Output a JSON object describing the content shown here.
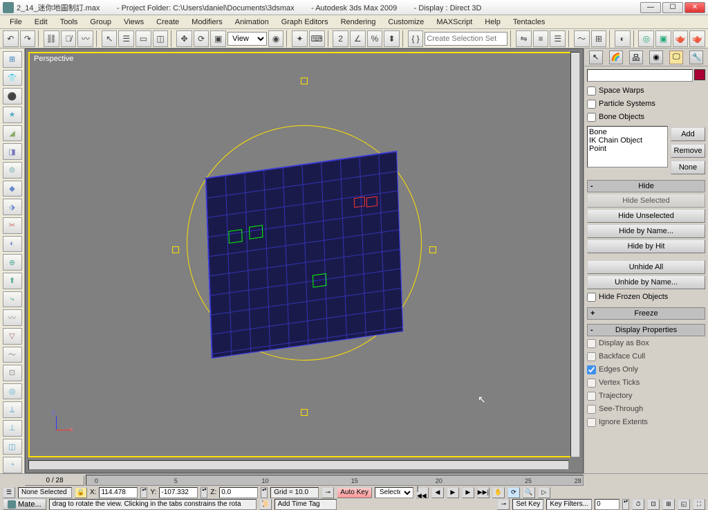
{
  "title": "2_14_迷你地圖制訂.max        - Project Folder: C:\\Users\\daniel\\Documents\\3dsmax        - Autodesk 3ds Max 2009        - Display : Direct 3D",
  "menus": [
    "File",
    "Edit",
    "Tools",
    "Group",
    "Views",
    "Create",
    "Modifiers",
    "Animation",
    "Graph Editors",
    "Rendering",
    "Customize",
    "MAXScript",
    "Help",
    "Tentacles"
  ],
  "toolbar": {
    "view_dropdown": "View",
    "selset_placeholder": "Create Selection Set"
  },
  "viewport": {
    "label": "Perspective",
    "axis_x": "x",
    "axis_z": "z"
  },
  "panel": {
    "search": "",
    "filters": {
      "space_warps": {
        "label": "Space Warps",
        "checked": false
      },
      "particle_systems": {
        "label": "Particle Systems",
        "checked": false
      },
      "bone_objects": {
        "label": "Bone Objects",
        "checked": false
      }
    },
    "list_items": [
      "Bone",
      "IK Chain Object",
      "Point"
    ],
    "btn_add": "Add",
    "btn_remove": "Remove",
    "btn_none": "None",
    "hide_rollout": "Hide",
    "btns_hide": [
      "Hide Selected",
      "Hide Unselected",
      "Hide by Name...",
      "Hide by Hit",
      "Unhide All",
      "Unhide by Name..."
    ],
    "hide_frozen": {
      "label": "Hide Frozen Objects",
      "checked": false
    },
    "freeze_rollout": "Freeze",
    "dispprops_rollout": "Display Properties",
    "dispprops": [
      {
        "label": "Display as Box",
        "checked": false
      },
      {
        "label": "Backface Cull",
        "checked": false
      },
      {
        "label": "Edges Only",
        "checked": true
      },
      {
        "label": "Vertex Ticks",
        "checked": false
      },
      {
        "label": "Trajectory",
        "checked": false
      },
      {
        "label": "See-Through",
        "checked": false
      },
      {
        "label": "Ignore Extents",
        "checked": false
      }
    ]
  },
  "timeline": {
    "slider": "0 / 28",
    "ticks": [
      "0",
      "5",
      "10",
      "15",
      "20",
      "25",
      "28"
    ]
  },
  "status": {
    "selection": "None Selected",
    "lock": "🔒",
    "x_lbl": "X:",
    "x": "114.478",
    "y_lbl": "Y:",
    "y": "-107.332",
    "z_lbl": "Z:",
    "z": "0.0",
    "grid": "Grid = 10.0",
    "autokey": "Auto Key",
    "selected": "Selected",
    "setkey": "Set Key",
    "keyfilters": "Key Filters...",
    "frame": "0"
  },
  "prompt": {
    "taskbtn": "Mate...",
    "help": "drag to rotate the view.  Clicking in the tabs constrains the rota",
    "addtag": "Add Time Tag"
  }
}
